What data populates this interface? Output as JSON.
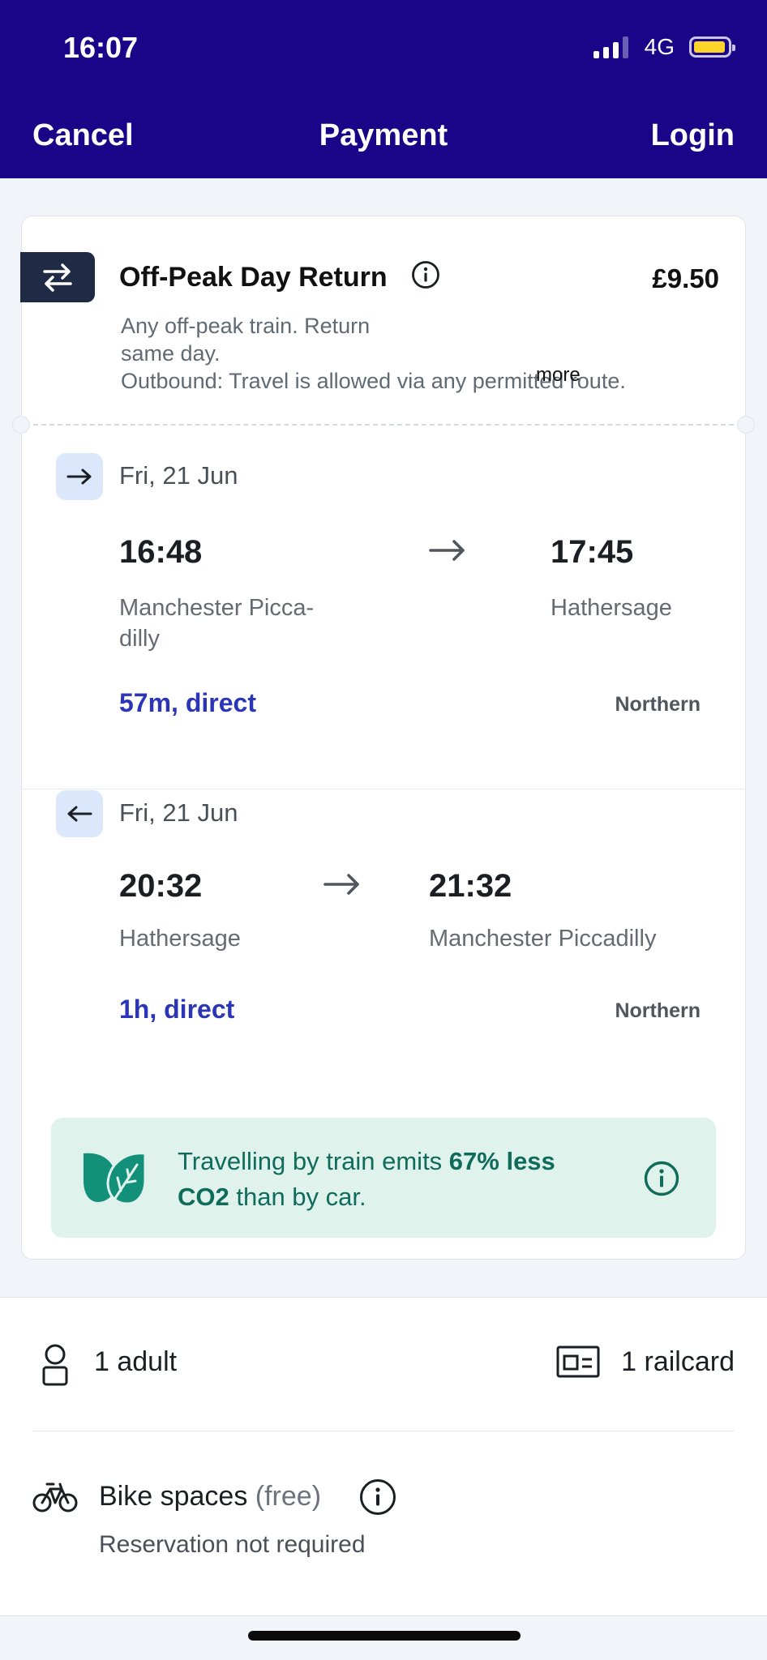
{
  "status_bar": {
    "time": "16:07",
    "network": "4G"
  },
  "nav": {
    "cancel": "Cancel",
    "title": "Payment",
    "login": "Login"
  },
  "ticket": {
    "name": "Off-Peak Day Return",
    "price": "£9.50",
    "description": "Any off-peak train. Return same day.",
    "outbound_note": "Outbound: Travel is allowed via any permitted route.",
    "more_link": "more"
  },
  "legs": [
    {
      "direction": "outbound",
      "date": "Fri, 21 Jun",
      "depart_time": "16:48",
      "depart_station": "Manchester Picca-\ndilly",
      "arrive_time": "17:45",
      "arrive_station": "Hathersage",
      "duration": "57m, direct",
      "operator": "Northern"
    },
    {
      "direction": "return",
      "date": "Fri, 21 Jun",
      "depart_time": "20:32",
      "depart_station": "Hathersage",
      "arrive_time": "21:32",
      "arrive_station": "Manchester Piccadilly",
      "duration": "1h, direct",
      "operator": "Northern"
    }
  ],
  "eco": {
    "text_before": "Travelling by train emits ",
    "highlight_1": "67% less",
    "highlight_2": "CO2",
    "text_after": " than by car."
  },
  "passengers": {
    "adults": "1 adult",
    "railcards": "1 railcard",
    "bike_label": "Bike spaces",
    "bike_free": "(free)",
    "bike_note": "Reservation not required"
  },
  "colors": {
    "header_bg": "#1a0487",
    "duration_link": "#2a35b8",
    "eco_bg": "#dff3ec",
    "eco_text": "#0f6b5a",
    "battery": "#ffd42a"
  }
}
